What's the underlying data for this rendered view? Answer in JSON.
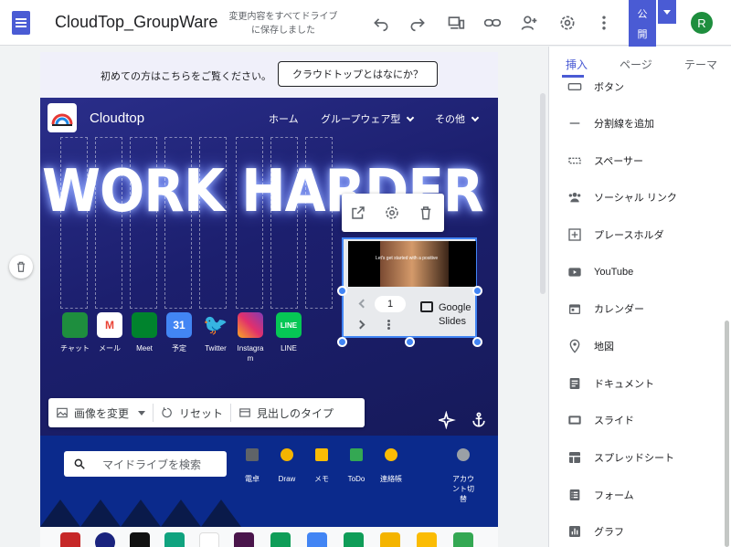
{
  "header": {
    "site_title": "CloudTop_GroupWare",
    "save_status": "変更内容をすべてドライブに保存しました",
    "publish_label_1": "公",
    "publish_label_2": "開",
    "avatar_letter": "R"
  },
  "banner": {
    "text": "初めての方はこちらをご覧ください。",
    "button": "クラウドトップとはなにか？"
  },
  "hero": {
    "site_name": "Cloudtop",
    "nav": [
      "ホーム",
      "グループウェア型",
      "その他"
    ],
    "neon_text": "WORK HARDER",
    "apps": [
      {
        "label": "チャット",
        "color": "#1e8e3e",
        "glyph": ""
      },
      {
        "label": "メール",
        "color": "#ea4335",
        "glyph": "M"
      },
      {
        "label": "Meet",
        "color": "#00832d",
        "glyph": ""
      },
      {
        "label": "予定",
        "color": "#4285f4",
        "glyph": "31"
      },
      {
        "label": "Twitter",
        "color": "#1da1f2",
        "glyph": ""
      },
      {
        "label": "Instagram",
        "color": "#c13584",
        "glyph": ""
      },
      {
        "label": "LINE",
        "color": "#06c755",
        "glyph": "LINE"
      }
    ],
    "embed": {
      "page_number": "1",
      "source": "Google Slides",
      "caption": "Let's get started with a positive"
    },
    "image_toolbar": {
      "change_image": "画像を変更",
      "reset": "リセット",
      "heading_type": "見出しのタイプ"
    }
  },
  "band2": {
    "search_placeholder": "マイドライブを検索",
    "icons": [
      {
        "label": "電卓",
        "color": "#5f6368"
      },
      {
        "label": "Draw",
        "color": "#f4b400"
      },
      {
        "label": "メモ",
        "color": "#fbbc04"
      },
      {
        "label": "ToDo",
        "color": "#34a853"
      },
      {
        "label": "連絡帳",
        "color": "#fbbc04"
      },
      {
        "label": "アカウント切替",
        "color": "#9aa0a6"
      }
    ]
  },
  "panel": {
    "tabs": [
      "挿入",
      "ページ",
      "テーマ"
    ],
    "items": [
      {
        "label": "ボタン",
        "icon": "button-icon"
      },
      {
        "label": "分割線を追加",
        "icon": "divider-icon"
      },
      {
        "label": "スペーサー",
        "icon": "spacer-icon"
      },
      {
        "label": "ソーシャル リンク",
        "icon": "people-icon"
      },
      {
        "label": "プレースホルダ",
        "icon": "placeholder-icon"
      },
      {
        "label": "YouTube",
        "icon": "youtube-icon"
      },
      {
        "label": "カレンダー",
        "icon": "calendar-icon"
      },
      {
        "label": "地図",
        "icon": "map-pin-icon"
      },
      {
        "label": "ドキュメント",
        "icon": "document-icon"
      },
      {
        "label": "スライド",
        "icon": "slides-icon"
      },
      {
        "label": "スプレッドシート",
        "icon": "sheets-icon"
      },
      {
        "label": "フォーム",
        "icon": "forms-icon"
      },
      {
        "label": "グラフ",
        "icon": "chart-icon"
      }
    ]
  },
  "colors": {
    "accent": "#4a5bd4",
    "selection": "#4285f4"
  }
}
